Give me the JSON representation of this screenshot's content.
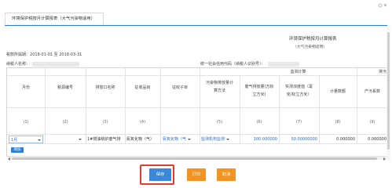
{
  "tab": {
    "title": "环境保护税按月计算报表（大气污染物适用）"
  },
  "report": {
    "title": "环境保护税按月计算报表",
    "subtitle": "（大气污染物适用）",
    "period_label": "税款所属期：",
    "period_value": "2018-01-01 至 2018-03-31",
    "taxpayer_label": "纳税人名称：",
    "credit_label": "统一社会信用代码（纳税人识别号）："
  },
  "table": {
    "headers": {
      "month": "月份",
      "tax_source_no": "税源编号",
      "outlet_name": "排放口名称",
      "levy_item": "征收品目",
      "levy_subitem": "征收子目",
      "calc_method_line1": "污染物排放量计",
      "calc_method_line2": "算方法",
      "monitor_group": "监测计算",
      "exhaust_volume_line1": "废气排放量(万标",
      "exhaust_volume_line2": "立方米)",
      "concentration_line1": "实测浓度值（毫",
      "concentration_line2": "克/标立方米）",
      "calc_volume": "计量数额",
      "pollution_group": "排污",
      "pollution_coef": "产污系数"
    },
    "col_numbers": [
      "(1)",
      "(2)",
      "(3)",
      "(4)",
      "(5)",
      "(6)",
      "(7)",
      "(8)",
      "(9)"
    ],
    "row": {
      "month": "1月",
      "outlet": "1#燃油锅炉废气排",
      "levy_item": "氮氧化物（气）",
      "levy_subitem": "氮氧化物（气",
      "method": "监测机构监测",
      "exhaust_volume": "100.000000",
      "concentration": "50.00000000",
      "calc_volume": "0.000000",
      "coef": "0.000000"
    },
    "add_label": "增加"
  },
  "buttons": {
    "save": "保存",
    "print": "打印",
    "cancel": "取消"
  },
  "colors": {
    "primary": "#3b87d9",
    "warning": "#f39322",
    "highlight": "#e53b2c",
    "link": "#2b6cc4"
  }
}
